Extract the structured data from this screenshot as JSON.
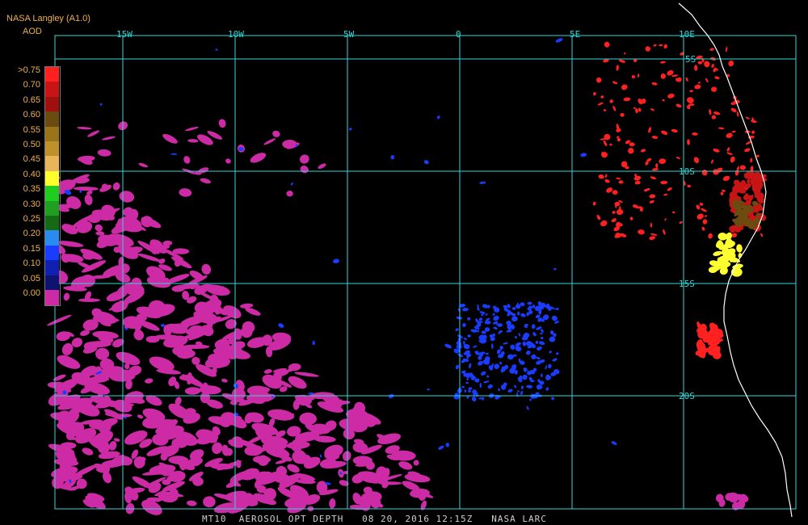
{
  "header": {
    "source": "NASA Langley (A1.0)",
    "product": "AOD"
  },
  "colorbar": {
    "labels": [
      ">0.75",
      "0.70",
      "0.65",
      "0.60",
      "0.55",
      "0.50",
      "0.45",
      "0.40",
      "0.35",
      "0.30",
      "0.25",
      "0.20",
      "0.15",
      "0.10",
      "0.05",
      "0.00"
    ],
    "colors": [
      "#ff2020",
      "#c81414",
      "#a01010",
      "#6b4b0f",
      "#9a7418",
      "#c0902a",
      "#e9b55b",
      "#ffff30",
      "#20cc20",
      "#20a020",
      "#146b14",
      "#2a8bee",
      "#1a3cff",
      "#1020b0",
      "#0c1370",
      "#cc2ba5"
    ]
  },
  "axes": {
    "lon_labels": [
      "15W",
      "10W",
      "5W",
      "0",
      "5E",
      "10E"
    ],
    "lat_labels": [
      "5S",
      "10S",
      "15S",
      "20S"
    ],
    "grid_color": "#33d6d6"
  },
  "footer": {
    "text": "MT10  AEROSOL OPT DEPTH   08 20, 2016 12:15Z   NASA LARC"
  },
  "colors": {
    "background": "#000000",
    "header_text": "#f0b050",
    "coastline": "#ffffff",
    "clean_aod": "#cc2ba5",
    "low_aod": "#1a3cff",
    "high_aod": "#ff2020",
    "very_high_aod": "#ffff30"
  }
}
